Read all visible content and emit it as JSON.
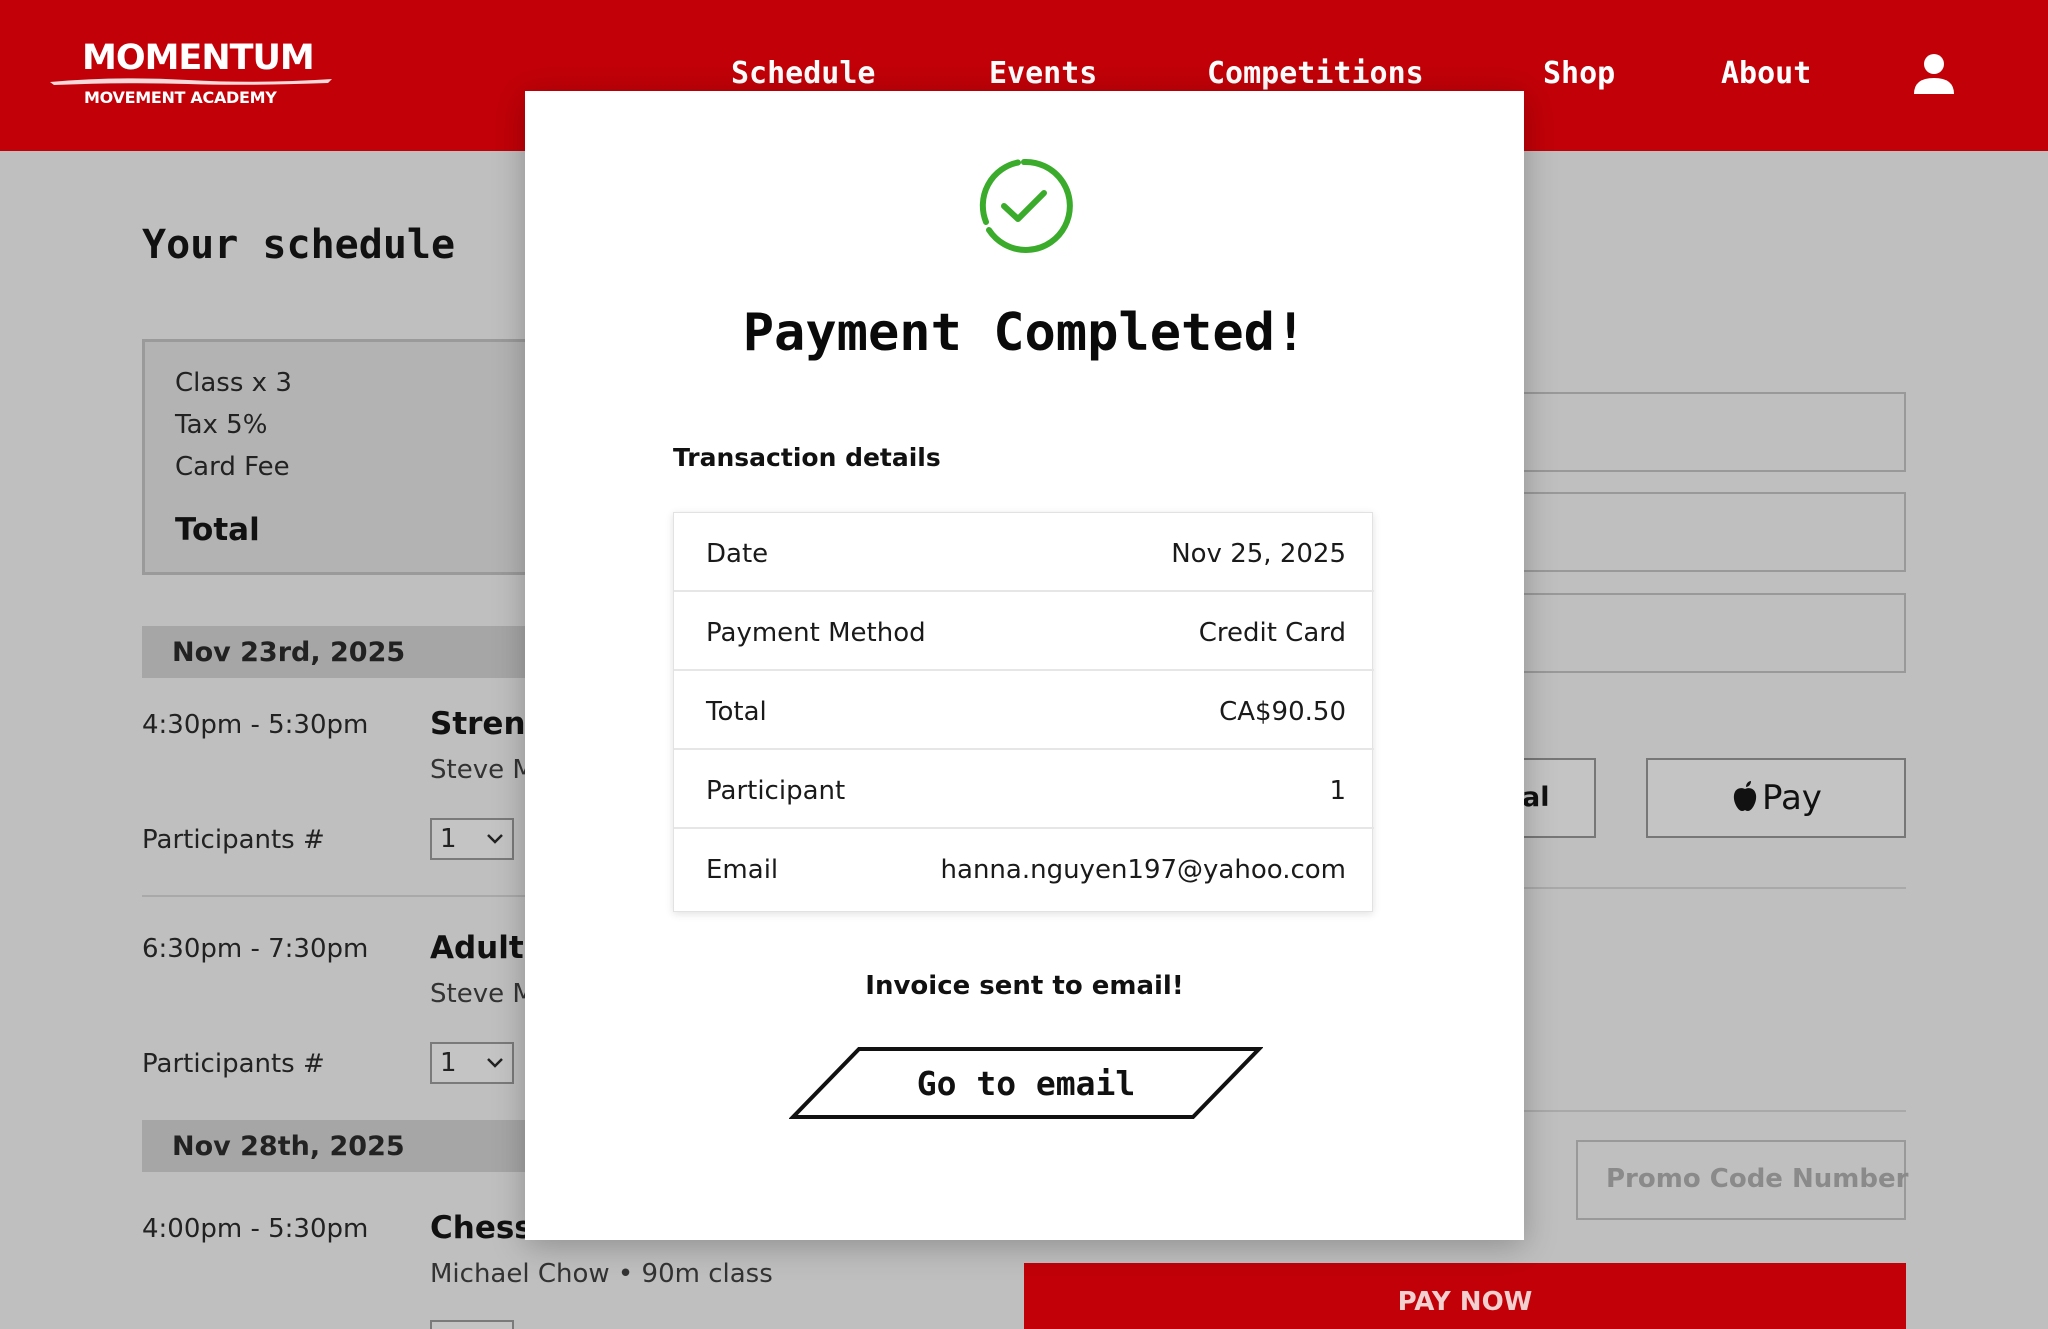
{
  "brand": {
    "name": "MOMENTUM",
    "tagline": "MOVEMENT ACADEMY"
  },
  "nav": {
    "items": [
      {
        "label": "Schedule"
      },
      {
        "label": "Events"
      },
      {
        "label": "Competitions"
      },
      {
        "label": "Shop"
      },
      {
        "label": "About"
      }
    ],
    "account_icon": "user-icon"
  },
  "page": {
    "title": "Your schedule",
    "summary": {
      "lines": [
        "Class x 3",
        "Tax 5%",
        "Card Fee"
      ],
      "total_label": "Total"
    },
    "schedule": [
      {
        "date": "Nov 23rd, 2025",
        "classes": [
          {
            "time": "4:30pm - 5:30pm",
            "name": "Streng",
            "instructor": "Steve M",
            "participants_label": "Participants #",
            "participants": "1"
          },
          {
            "time": "6:30pm - 7:30pm",
            "name": "Adults",
            "instructor": "Steve M",
            "participants_label": "Participants #",
            "participants": "1"
          }
        ]
      },
      {
        "date": "Nov 28th, 2025",
        "classes": [
          {
            "time": "4:00pm - 5:30pm",
            "name": "Chess",
            "instructor": "Michael Chow",
            "duration": "90m class"
          }
        ]
      }
    ],
    "payment_options": {
      "paypal_partial": "al",
      "apple_pay": "Pay"
    },
    "promo_placeholder": "Promo Code Number",
    "pay_now": "PAY NOW"
  },
  "modal": {
    "icon": "check-circle-icon",
    "title": "Payment Completed!",
    "section_label": "Transaction details",
    "details": [
      {
        "label": "Date",
        "value": "Nov 25, 2025"
      },
      {
        "label": "Payment Method",
        "value": "Credit Card"
      },
      {
        "label": "Total",
        "value": "CA$90.50"
      },
      {
        "label": "Participant",
        "value": "1"
      },
      {
        "label": "Email",
        "value": "hanna.nguyen197@yahoo.com"
      }
    ],
    "invoice_text": "Invoice sent to email!",
    "button_label": "Go to email"
  },
  "colors": {
    "brand_red": "#c20008",
    "success_green": "#3aab2b",
    "overlay_gray": "#bfbfbf"
  }
}
